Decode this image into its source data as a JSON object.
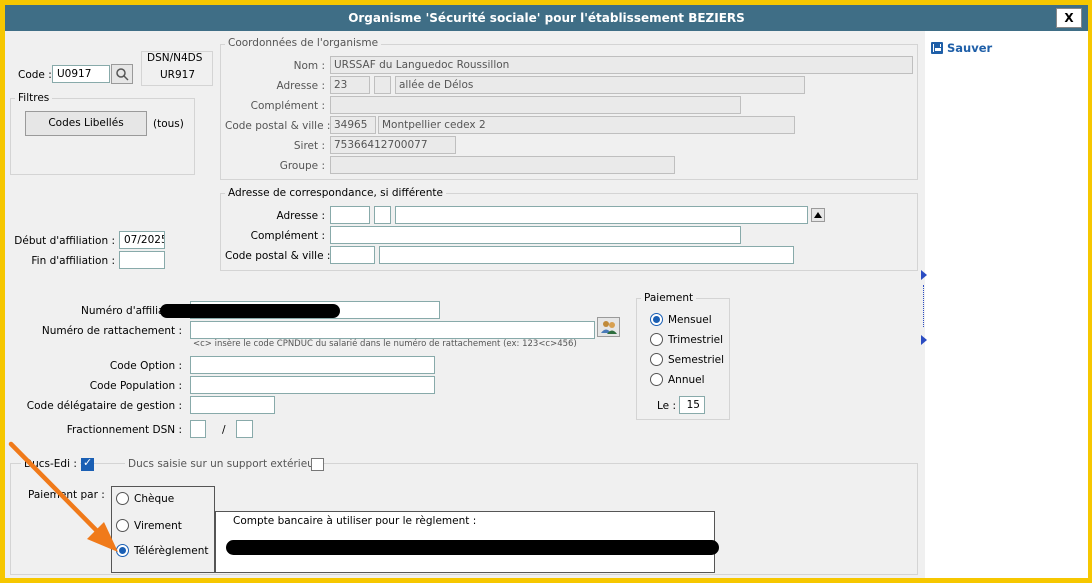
{
  "window": {
    "title": "Organisme 'Sécurité sociale' pour l'établissement BEZIERS",
    "close_label": "X"
  },
  "toolbar": {
    "save_label": "Sauver",
    "save_icon": "floppy-disk-icon"
  },
  "header": {
    "code_label": "Code :",
    "code_value": "U0917",
    "dsn_label": "DSN/N4DS",
    "dsn_value": "UR917"
  },
  "filters": {
    "title": "Filtres",
    "codes_button": "Codes Libellés",
    "tous": "(tous)"
  },
  "organisme": {
    "title": "Coordonnées de l'organisme",
    "nom_label": "Nom :",
    "nom": "URSSAF du Languedoc Roussillon",
    "adresse_label": "Adresse :",
    "adresse_num": "23",
    "adresse_bis": "",
    "adresse_voie": "allée de Délos",
    "complement_label": "Complément :",
    "complement": "",
    "cp_label": "Code postal & ville :",
    "cp": "34965",
    "ville": "Montpellier cedex 2",
    "siret_label": "Siret :",
    "siret": "75366412700077",
    "groupe_label": "Groupe :",
    "groupe": ""
  },
  "correspondance": {
    "title": "Adresse de correspondance, si différente",
    "adresse_label": "Adresse :",
    "complement_label": "Complément :",
    "cp_label": "Code postal & ville :"
  },
  "affiliation": {
    "debut_label": "Début d'affiliation :",
    "debut": "07/2025",
    "fin_label": "Fin d'affiliation :",
    "fin": ""
  },
  "numeros": {
    "affiliation_label": "Numéro d'affiliati",
    "rattachement_label": "Numéro de rattachement :",
    "help": "<c> insère le code CPNDUC du salarié dans le numéro de rattachement (ex: 123<c>456)",
    "option_label": "Code Option :",
    "population_label": "Code Population :",
    "delegataire_label": "Code délégataire de gestion :",
    "fractionnement_label": "Fractionnement DSN :",
    "fractionnement_sep": "/"
  },
  "paiement": {
    "title": "Paiement",
    "options": [
      "Mensuel",
      "Trimestriel",
      "Semestriel",
      "Annuel"
    ],
    "selected": 0,
    "le_label": "Le :",
    "le_value": "15"
  },
  "ducs": {
    "edi_label": "Ducs-Edi :",
    "support_label": "Ducs saisie sur un support extérieur",
    "paiement_par_label": "Paiement par :",
    "methods": [
      "Chèque",
      "Virement",
      "Télérèglement"
    ],
    "selected": 2,
    "compte_label": "Compte bancaire à utiliser pour le règlement :"
  },
  "colors": {
    "title_bg": "#3f6e86",
    "frame": "#f6c700",
    "accent": "#1a5fb4",
    "arrow": "#f07a1a"
  }
}
